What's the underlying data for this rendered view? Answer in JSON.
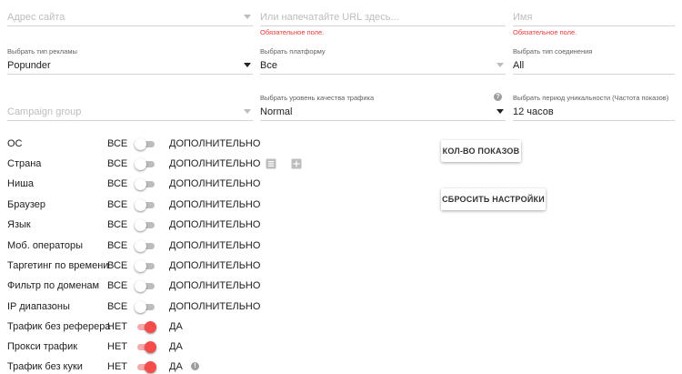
{
  "top": {
    "site_address_placeholder": "Адрес сайта",
    "url_placeholder": "Или напечатайте URL здесь...",
    "url_error": "Обязательное поле.",
    "name_placeholder": "Имя",
    "name_error": "Обязательное поле."
  },
  "ad_type": {
    "label": "Выбрать тип рекламы",
    "value": "Popunder"
  },
  "platform": {
    "label": "Выбрать платформу",
    "value": "Все"
  },
  "connection": {
    "label": "Выбрать тип соединения",
    "value": "All"
  },
  "campaign_group": {
    "placeholder": "Campaign group"
  },
  "traffic_quality": {
    "label": "Выбрать уровень качества трафика",
    "value": "Normal"
  },
  "uniqueness": {
    "label": "Выбрать период уникальности (Частота показов)",
    "value": "12 часов"
  },
  "buttons": {
    "impressions": "КОЛ-ВО ПОКАЗОВ",
    "reset": "СБРОСИТЬ НАСТРОЙКИ"
  },
  "filters": [
    {
      "label": "ОС",
      "left": "ВСЕ",
      "right": "ДОПОЛНИТЕЛЬНО",
      "on": false
    },
    {
      "label": "Страна",
      "left": "ВСЕ",
      "right": "ДОПОЛНИТЕЛЬНО",
      "on": false
    },
    {
      "label": "Ниша",
      "left": "ВСЕ",
      "right": "ДОПОЛНИТЕЛЬНО",
      "on": false
    },
    {
      "label": "Браузер",
      "left": "ВСЕ",
      "right": "ДОПОЛНИТЕЛЬНО",
      "on": false
    },
    {
      "label": "Язык",
      "left": "ВСЕ",
      "right": "ДОПОЛНИТЕЛЬНО",
      "on": false
    },
    {
      "label": "Моб. операторы",
      "left": "ВСЕ",
      "right": "ДОПОЛНИТЕЛЬНО",
      "on": false
    },
    {
      "label": "Таргетинг по времени",
      "left": "ВСЕ",
      "right": "ДОПОЛНИТЕЛЬНО",
      "on": false
    },
    {
      "label": "Фильтр по доменам",
      "left": "ВСЕ",
      "right": "ДОПОЛНИТЕЛЬНО",
      "on": false
    },
    {
      "label": "IP диапазоны",
      "left": "ВСЕ",
      "right": "ДОПОЛНИТЕЛЬНО",
      "on": false
    },
    {
      "label": "Трафик без реферера",
      "left": "НЕТ",
      "right": "ДА",
      "on": true
    },
    {
      "label": "Прокси трафик",
      "left": "НЕТ",
      "right": "ДА",
      "on": true
    },
    {
      "label": "Трафик без куки",
      "left": "НЕТ",
      "right": "ДА",
      "on": true
    }
  ],
  "colors": {
    "accent": "#f44b4b",
    "error": "#e53935"
  },
  "icons": [
    "list-icon",
    "add-box-icon",
    "help-icon"
  ]
}
